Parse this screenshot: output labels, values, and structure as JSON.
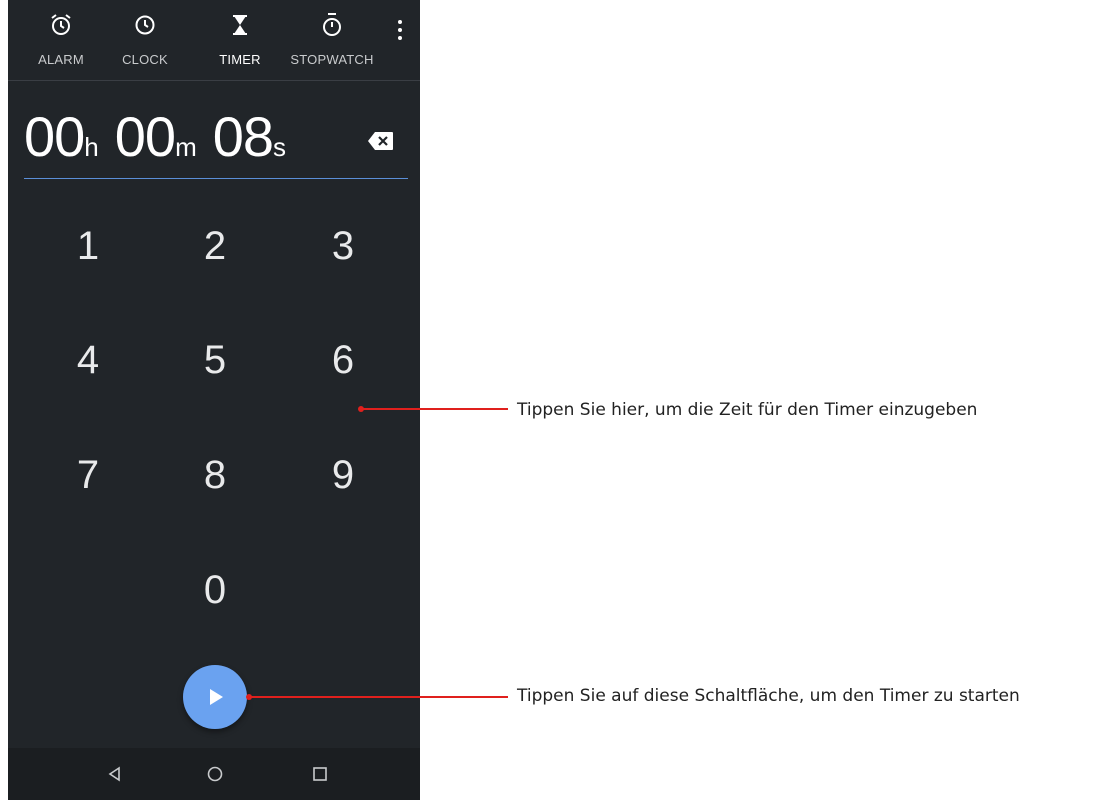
{
  "tabs": [
    {
      "label": "ALARM",
      "icon": "alarm-icon",
      "active": false
    },
    {
      "label": "CLOCK",
      "icon": "clock-icon",
      "active": false
    },
    {
      "label": "TIMER",
      "icon": "hourglass-icon",
      "active": true
    },
    {
      "label": "STOPWATCH",
      "icon": "stopwatch-icon",
      "active": false
    }
  ],
  "timer": {
    "hours": "00",
    "hours_unit": "h",
    "minutes": "00",
    "minutes_unit": "m",
    "seconds": "08",
    "seconds_unit": "s"
  },
  "keypad": [
    "1",
    "2",
    "3",
    "4",
    "5",
    "6",
    "7",
    "8",
    "9",
    "0"
  ],
  "callouts": {
    "keypad": "Tippen Sie hier, um die Zeit für den Timer einzugeben",
    "start": "Tippen Sie auf diese Schaltfläche, um den Timer zu starten"
  },
  "colors": {
    "background": "#212529",
    "accent": "#6aa2f0",
    "callout": "#e0201d"
  }
}
